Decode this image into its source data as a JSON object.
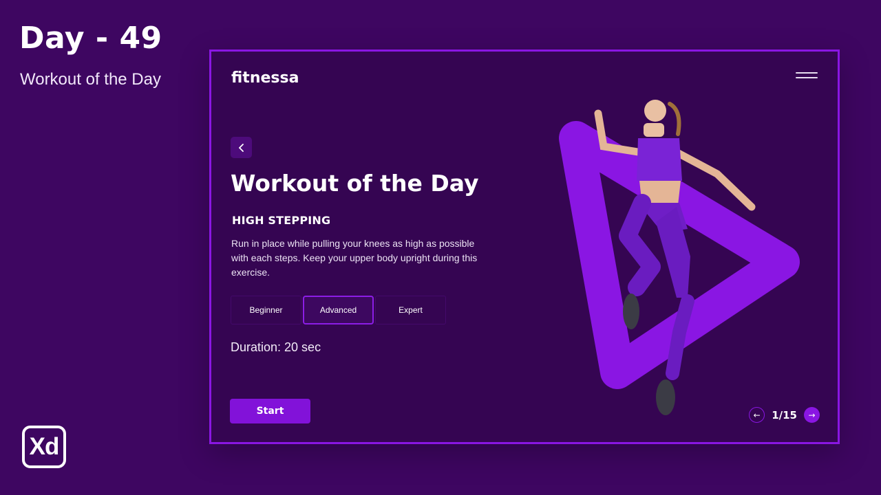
{
  "slide": {
    "day_label": "Day - 49",
    "subtitle": "Workout of the Day",
    "tool_logo": "Xd"
  },
  "app": {
    "brand": "fitnessa",
    "menu_icon": "hamburger-icon",
    "back_icon": "chevron-left-icon",
    "heading": "Workout of the Day",
    "exercise_name": "HIGH STEPPING",
    "description": "Run in place while pulling your knees as high as possible with each steps. Keep your upper body upright during this exercise.",
    "levels": [
      {
        "label": "Beginner"
      },
      {
        "label": "Advanced"
      },
      {
        "label": "Expert"
      }
    ],
    "selected_level": "Advanced",
    "duration": "Duration: 20 sec",
    "start_label": "Start",
    "pager": {
      "prev_glyph": "←",
      "next_glyph": "→",
      "counter": "1/15"
    }
  },
  "colors": {
    "background": "#3e0661",
    "card": "#350552",
    "accent": "#8a16e3",
    "button": "#8212d9"
  }
}
